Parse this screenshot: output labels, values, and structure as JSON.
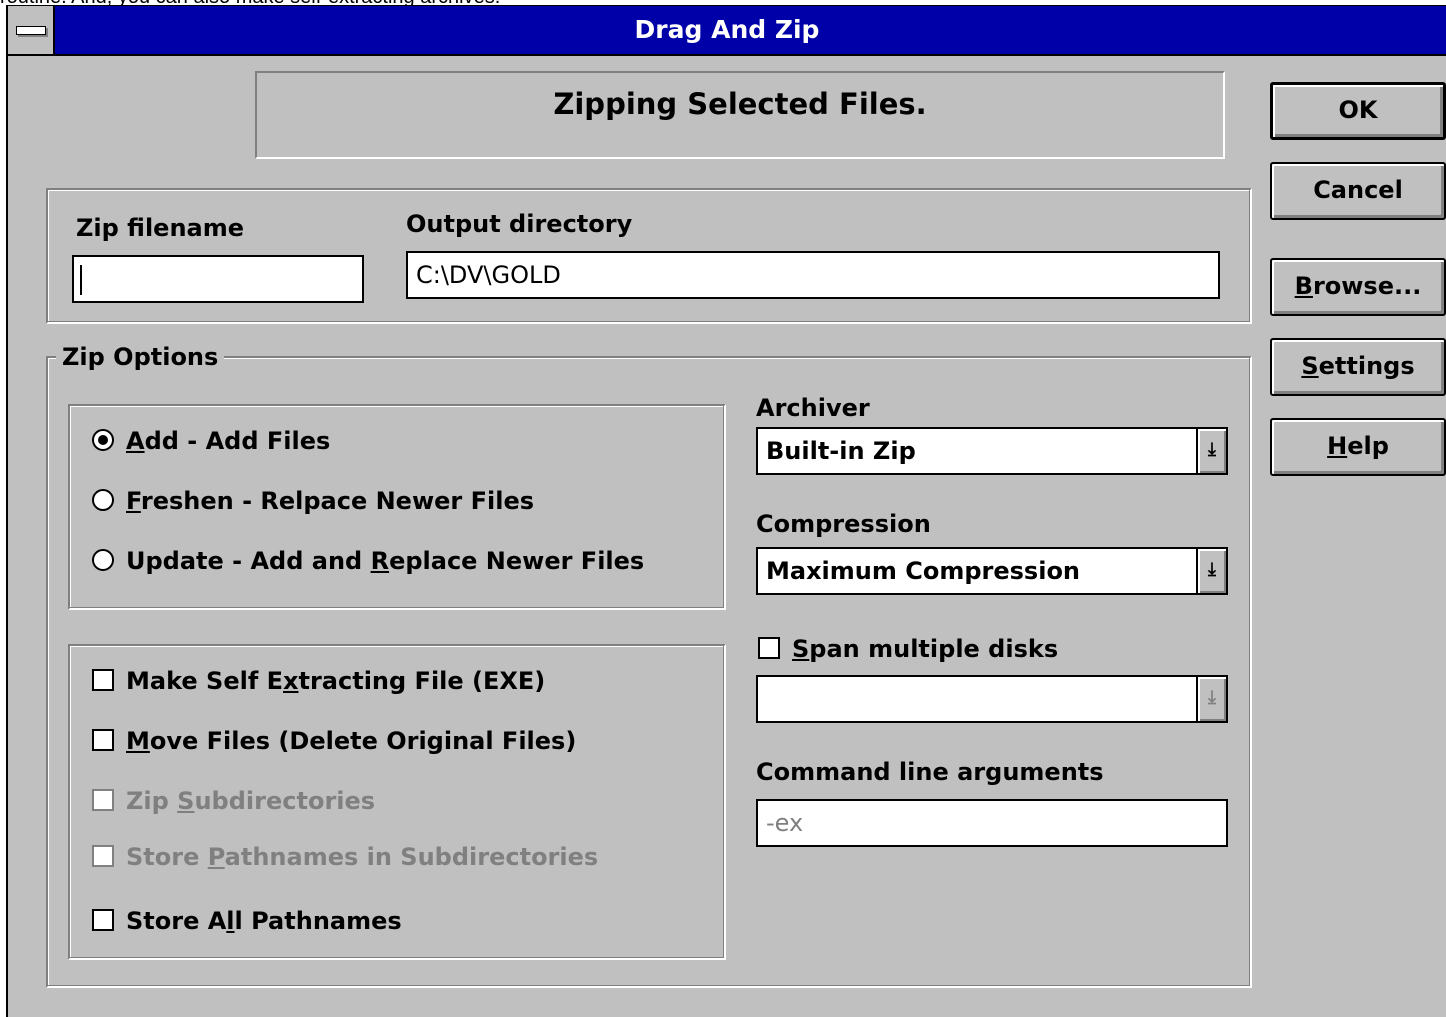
{
  "background_text": "routine. And, you can also make self-extracting archives.",
  "window": {
    "title": "Drag And Zip"
  },
  "banner": {
    "text": "Zipping Selected Files."
  },
  "fields": {
    "zip_filename_label": "Zip filename",
    "zip_filename_value": "",
    "output_dir_label": "Output directory",
    "output_dir_value": "C:\\DV\\GOLD"
  },
  "zip_options": {
    "legend": "Zip Options",
    "radios": [
      {
        "pre": "",
        "key": "A",
        "post": "dd - Add Files",
        "selected": true
      },
      {
        "pre": "",
        "key": "F",
        "post": "reshen - Relpace Newer Files",
        "selected": false
      },
      {
        "pre": "Update - Add and ",
        "key": "R",
        "post": "eplace Newer Files",
        "selected": false
      }
    ],
    "checks": [
      {
        "pre": "Make Self E",
        "key": "x",
        "post": "tracting File (EXE)",
        "checked": false,
        "disabled": false
      },
      {
        "pre": "",
        "key": "M",
        "post": "ove Files (Delete Original Files)",
        "checked": false,
        "disabled": false
      },
      {
        "pre": "Zip ",
        "key": "S",
        "post": "ubdirectories",
        "checked": false,
        "disabled": true
      },
      {
        "pre": "Store ",
        "key": "P",
        "post": "athnames in Subdirectories",
        "checked": false,
        "disabled": true
      },
      {
        "pre": "Store A",
        "key": "l",
        "post": "l Pathnames",
        "checked": false,
        "disabled": false
      }
    ]
  },
  "right_panel": {
    "archiver_label": "Archiver",
    "archiver_value": "Built-in Zip",
    "compression_label": "Compression",
    "compression_value": "Maximum Compression",
    "span_pre": "",
    "span_key": "S",
    "span_post": "pan multiple disks",
    "span_value": "",
    "cmd_label": "Command line arguments",
    "cmd_value": "-ex"
  },
  "buttons": {
    "ok": {
      "pre": "",
      "key": "",
      "post": "OK"
    },
    "cancel": {
      "pre": "",
      "key": "",
      "post": "Cancel"
    },
    "browse": {
      "pre": "",
      "key": "B",
      "post": "rowse..."
    },
    "settings": {
      "pre": "",
      "key": "S",
      "post": "ettings"
    },
    "help": {
      "pre": "",
      "key": "H",
      "post": "elp"
    }
  }
}
